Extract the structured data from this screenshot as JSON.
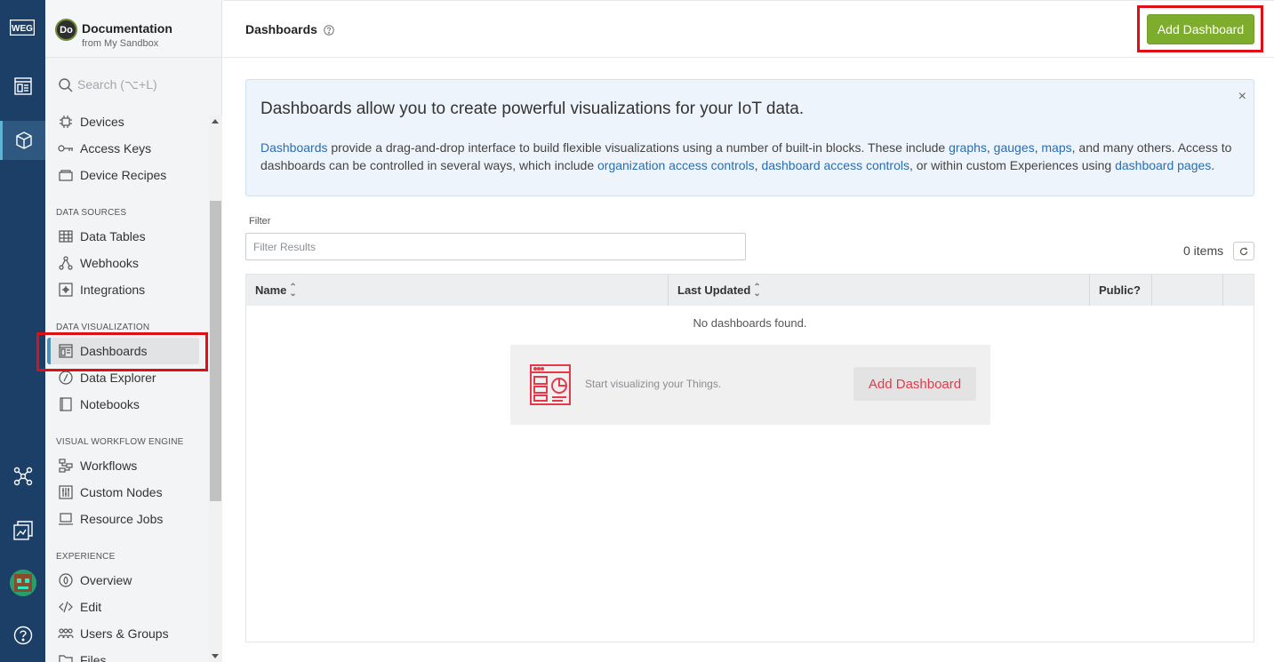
{
  "rail": {
    "logo_text": "WEG",
    "icons": [
      "dashboard-rail-icon",
      "cube-rail-icon",
      "workflow-rail-icon",
      "experience-rail-icon",
      "user-avatar",
      "help-rail-icon"
    ]
  },
  "app": {
    "avatar_initials": "Do",
    "title": "Documentation",
    "subtitle": "from My Sandbox"
  },
  "search": {
    "placeholder": "Search (⌥+L)"
  },
  "nav": {
    "items_top": [
      {
        "label": "Devices",
        "icon": "chip-icon"
      },
      {
        "label": "Access Keys",
        "icon": "key-icon"
      },
      {
        "label": "Device Recipes",
        "icon": "recipe-icon"
      }
    ],
    "sections": [
      {
        "title": "DATA SOURCES",
        "items": [
          {
            "label": "Data Tables",
            "icon": "table-icon"
          },
          {
            "label": "Webhooks",
            "icon": "webhook-icon"
          },
          {
            "label": "Integrations",
            "icon": "integration-icon"
          }
        ]
      },
      {
        "title": "DATA VISUALIZATION",
        "items": [
          {
            "label": "Dashboards",
            "icon": "dashboard-icon",
            "selected": true
          },
          {
            "label": "Data Explorer",
            "icon": "compass-icon"
          },
          {
            "label": "Notebooks",
            "icon": "notebook-icon"
          }
        ]
      },
      {
        "title": "VISUAL WORKFLOW ENGINE",
        "items": [
          {
            "label": "Workflows",
            "icon": "workflow-icon"
          },
          {
            "label": "Custom Nodes",
            "icon": "sliders-icon"
          },
          {
            "label": "Resource Jobs",
            "icon": "laptop-icon"
          }
        ]
      },
      {
        "title": "EXPERIENCE",
        "items": [
          {
            "label": "Overview",
            "icon": "overview-icon"
          },
          {
            "label": "Edit",
            "icon": "code-icon"
          },
          {
            "label": "Users & Groups",
            "icon": "users-icon"
          },
          {
            "label": "Files",
            "icon": "folder-icon"
          }
        ]
      }
    ]
  },
  "header": {
    "title": "Dashboards",
    "add_button": "Add Dashboard"
  },
  "info": {
    "title": "Dashboards allow you to create powerful visualizations for your IoT data.",
    "close": "×",
    "link_dashboards": "Dashboards",
    "text1": " provide a drag-and-drop interface to build flexible visualizations using a number of built-in blocks. These include ",
    "link_graphs": "graphs",
    "sep1": ", ",
    "link_gauges": "gauges",
    "sep2": ", ",
    "link_maps": "maps",
    "text2": ", and many others. Access to dashboards can be controlled in several ways, which include ",
    "link_org": "organization access controls",
    "sep3": ", ",
    "link_dash_ac": "dashboard access controls",
    "text3": ", or within custom Experiences using ",
    "link_pages": "dashboard pages",
    "text4": "."
  },
  "filter": {
    "label": "Filter",
    "placeholder": "Filter Results"
  },
  "list": {
    "count": "0 items",
    "columns": [
      "Name",
      "Last Updated",
      "Public?"
    ],
    "empty_text": "No dashboards found.",
    "empty_caption": "Start visualizing your Things.",
    "empty_button": "Add Dashboard"
  },
  "colors": {
    "rail_bg": "#1b3f66",
    "primary_button": "#7ead2d",
    "link": "#2a6db0",
    "empty_accent": "#e5394a",
    "highlight": "#e00f16"
  }
}
